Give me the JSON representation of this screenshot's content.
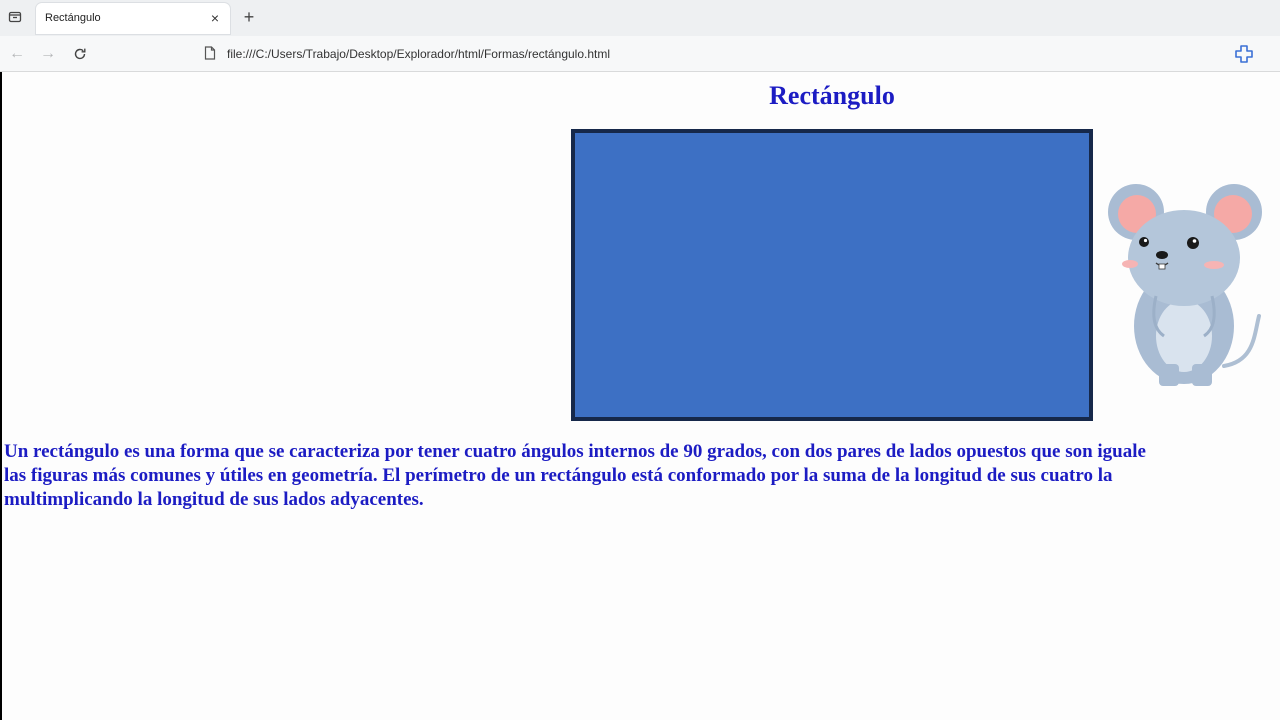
{
  "browser": {
    "tab_title": "Rectángulo",
    "tab_close": "×",
    "new_tab": "+",
    "url": "file:///C:/Users/Trabajo/Desktop/Explorador/html/Formas/rectángulo.html"
  },
  "page": {
    "title": "Rectángulo",
    "rectangle_color": "#3d70c4",
    "rectangle_border_color": "#16284a",
    "text_color": "#1c1cc3",
    "description_lines": [
      "Un rectángulo es una forma que se caracteriza por tener cuatro ángulos internos de 90 grados, con dos pares de lados opuestos que son iguale",
      "las figuras más comunes y útiles en geometría. El perímetro de un rectángulo está conformado por la suma de la longitud de sus cuatro la",
      "multimplicando la longitud de sus lados adyacentes."
    ],
    "illustration": "mouse-illustration"
  }
}
